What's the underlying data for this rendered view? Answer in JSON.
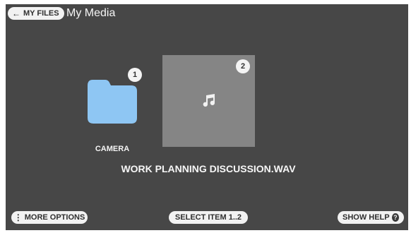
{
  "header": {
    "back_label": "MY FILES",
    "back_arrow": "←",
    "title": "My Media"
  },
  "items": [
    {
      "name": "CAMERA",
      "badge": "1",
      "type": "folder",
      "color": "#8ec6f3"
    },
    {
      "name": "",
      "badge": "2",
      "type": "audio",
      "color": "#858585"
    }
  ],
  "selected_file": "WORK PLANNING DISCUSSION.WAV",
  "footer": {
    "more_options": "MORE OPTIONS",
    "more_options_icon": "⋮",
    "select_item": "SELECT ITEM 1..2",
    "show_help": "SHOW HELP",
    "help_icon": "?"
  },
  "colors": {
    "screen_background": "#474747",
    "pill_background": "#f2f2f2",
    "text_light": "#f5f5f5"
  }
}
